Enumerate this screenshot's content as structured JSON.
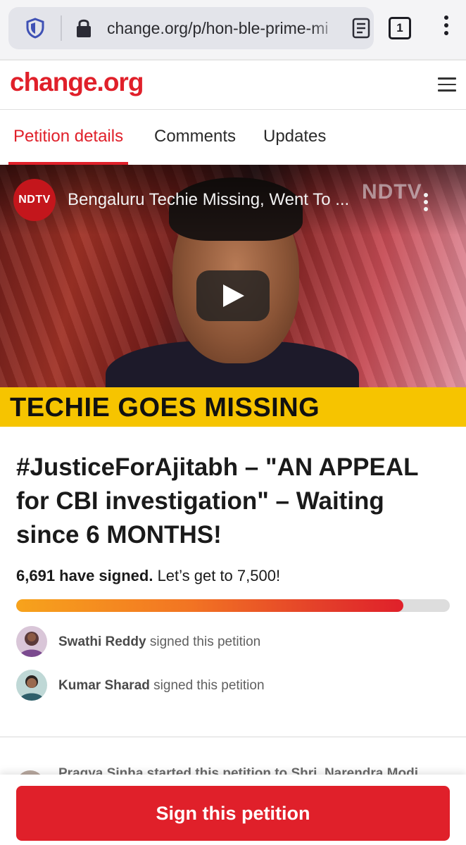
{
  "browser": {
    "url": "change.org/p/hon-ble-prime-mi",
    "tab_count": "1",
    "icons": [
      "shield-icon",
      "lock-icon",
      "reader-mode-icon",
      "tabs-icon",
      "more-vert-icon"
    ]
  },
  "header": {
    "logo": "change.org",
    "menu_icon": "hamburger-icon"
  },
  "tabs": [
    {
      "label": "Petition details",
      "active": true
    },
    {
      "label": "Comments",
      "active": false
    },
    {
      "label": "Updates",
      "active": false
    }
  ],
  "video": {
    "channel": "NDTV",
    "title": "Bengaluru Techie Missing, Went To ...",
    "watermark": "NDTV",
    "banner": "TECHIE GOES MISSING"
  },
  "petition": {
    "title": "#JusticeForAjitabh – \"AN APPEAL for CBI investigation\" – Waiting since 6 MONTHS!",
    "signed_count_text": "6,691 have signed.",
    "goal_text": "Let’s get to 7,500!",
    "signed": 6691,
    "goal": 7500,
    "progress_fraction": 0.8921
  },
  "signers": [
    {
      "name": "Swathi Reddy",
      "action": "signed this petition"
    },
    {
      "name": "Kumar Sharad",
      "action": "signed this petition"
    }
  ],
  "starter": {
    "text": "Pragya Sinha started this petition to Shri. Narendra Modi"
  },
  "cta": {
    "label": "Sign this petition"
  },
  "colors": {
    "brand_red": "#e0202a",
    "banner_yellow": "#f6c400",
    "progress_start": "#f7a31c",
    "progress_end": "#e0202a"
  }
}
